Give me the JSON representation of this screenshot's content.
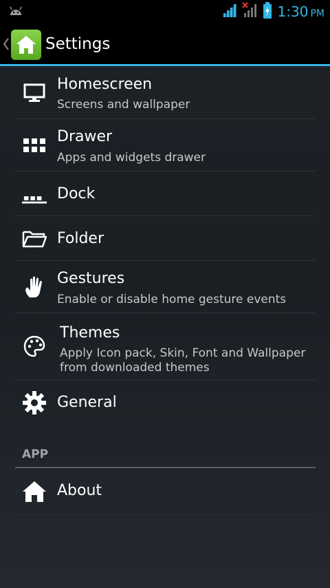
{
  "status_bar": {
    "time": "1:30",
    "ampm": "PM",
    "accent": "#33b5e5"
  },
  "action_bar": {
    "title": "Settings",
    "icon": "home-icon",
    "accent": "#33b5e5"
  },
  "items": [
    {
      "title": "Homescreen",
      "summary": "Screens and wallpaper",
      "icon": "monitor-icon"
    },
    {
      "title": "Drawer",
      "summary": "Apps and widgets drawer",
      "icon": "grid-icon"
    },
    {
      "title": "Dock",
      "icon": "dock-icon"
    },
    {
      "title": "Folder",
      "icon": "folder-icon"
    },
    {
      "title": "Gestures",
      "summary": "Enable or disable home gesture events",
      "icon": "hand-icon"
    },
    {
      "title": "Themes",
      "summary": "Apply Icon pack, Skin, Font and Wallpaper",
      "summary2": "from downloaded themes",
      "icon": "palette-icon"
    },
    {
      "title": "General",
      "icon": "gear-icon"
    }
  ],
  "app_section": {
    "header": "APP",
    "items": [
      {
        "title": "About",
        "icon": "house-icon"
      }
    ]
  }
}
